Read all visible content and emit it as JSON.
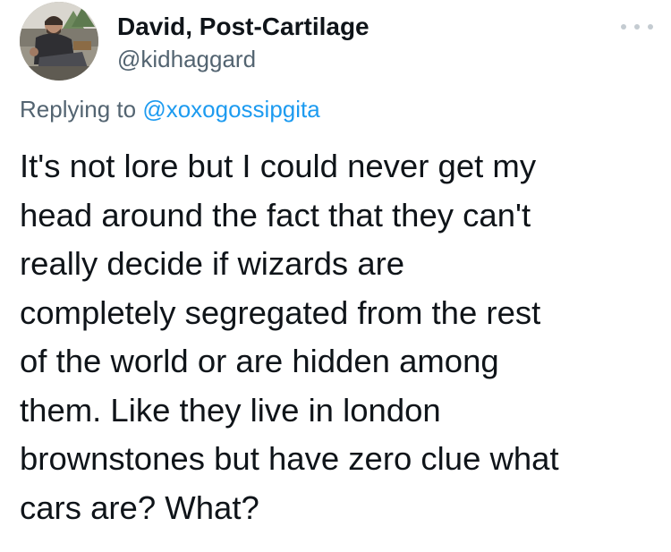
{
  "author": {
    "display_name": "David, Post-Cartilage",
    "handle": "@kidhaggard",
    "avatar_icon": "profile-photo"
  },
  "more_icon": "more-options-icon",
  "reply": {
    "prefix": "Replying to",
    "target": "@xoxogossipgita"
  },
  "tweet": {
    "lines": [
      "It's not lore but I could never get my",
      "head around the fact that they can't",
      "really decide if wizards are",
      "completely segregated from the rest",
      "of the world or are hidden among",
      "them. Like they live in london",
      "brownstones but have zero clue what",
      "cars are? What?"
    ]
  },
  "colors": {
    "text_primary": "#0f1419",
    "text_secondary": "#536471",
    "link": "#1d9bf0",
    "dots": "#c4cbd1"
  }
}
